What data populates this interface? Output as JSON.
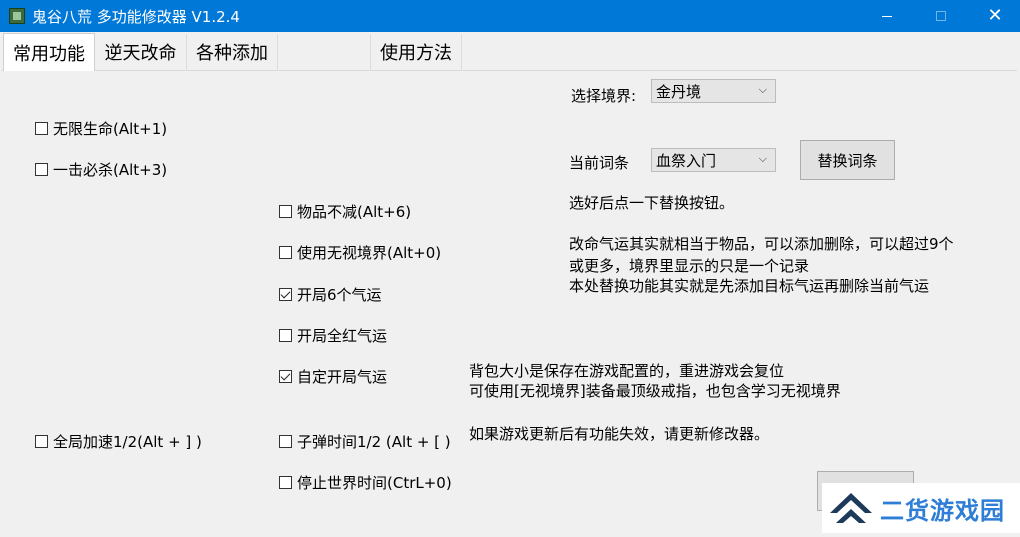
{
  "window": {
    "title": "鬼谷八荒 多功能修改器  V1.2.4",
    "close_glyph": "✕"
  },
  "tabs": [
    {
      "label": "常用功能"
    },
    {
      "label": "逆天改命"
    },
    {
      "label": "各种添加"
    },
    {
      "label": ""
    },
    {
      "label": "使用方法"
    }
  ],
  "checkboxes": {
    "infinite_life": {
      "label": "无限生命(Alt+1)",
      "checked": false
    },
    "one_hit_kill": {
      "label": "一击必杀(Alt+3)",
      "checked": false
    },
    "items_no_decrease": {
      "label": "物品不减(Alt+6)",
      "checked": false
    },
    "ignore_realm": {
      "label": "使用无视境界(Alt+0)",
      "checked": false
    },
    "six_fortunes": {
      "label": "开局6个气运",
      "checked": true
    },
    "all_red_fortunes": {
      "label": "开局全红气运",
      "checked": false
    },
    "custom_fortunes": {
      "label": "自定开局气运",
      "checked": true
    },
    "global_speed": {
      "label": "全局加速1/2(Alt + ] )",
      "checked": false
    },
    "bullet_time": {
      "label": "子弹时间1/2 (Alt + [ )",
      "checked": false
    },
    "stop_world_time": {
      "label": "停止世界时间(CtrL+0)",
      "checked": false
    }
  },
  "realm": {
    "label": "选择境界:",
    "selected": "金丹境"
  },
  "trait": {
    "label": "当前词条",
    "selected": "血祭入门",
    "replace_button": "替换词条"
  },
  "notes": {
    "replace_hint": "选好后点一下替换按钮。",
    "fortune_line1": "改命气运其实就相当于物品，可以添加删除，可以超过9个",
    "fortune_line2": "或更多，境界里显示的只是一个记录",
    "fortune_line3": "本处替换功能其实就是先添加目标气运再删除当前气运",
    "bag_line1": "背包大小是保存在游戏配置的，重进游戏会复位",
    "bag_line2": "可使用[无视境界]装备最顶级戒指，也包含学习无视境界",
    "update_hint": "如果游戏更新后有功能失效，请更新修改器。"
  },
  "watermark": {
    "text": "二货游戏园"
  },
  "colors": {
    "titlebar": "#0078d7",
    "panel": "#f0f0f0",
    "watermark_text": "#2e7dd6",
    "watermark_logo": "#1e3a5a"
  }
}
